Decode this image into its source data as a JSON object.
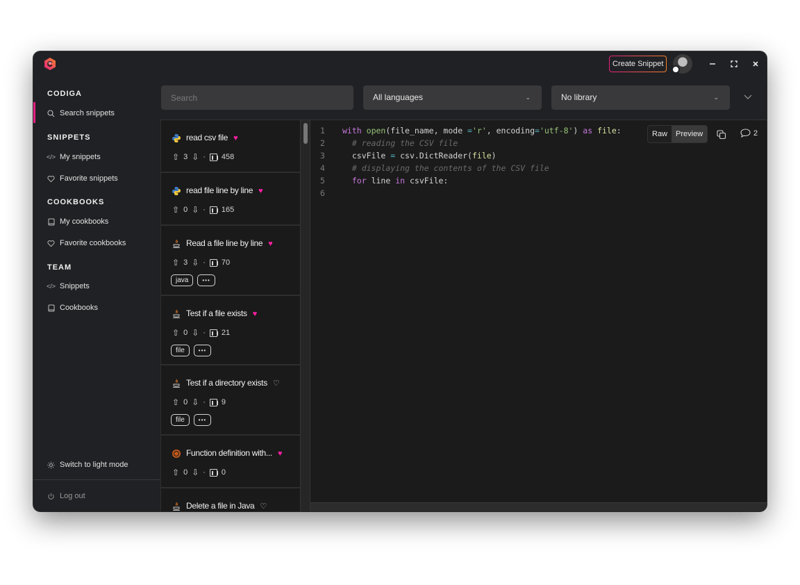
{
  "app": {
    "name": "CODIGA",
    "brand_colors": {
      "primary": "#e5207f",
      "secondary": "#f4842b"
    }
  },
  "titlebar": {
    "create_snippet_label": "Create Snippet",
    "window_controls": [
      "minimize-icon",
      "maximize-icon",
      "close-icon"
    ]
  },
  "sidebar": {
    "sections": [
      {
        "title": "CODIGA",
        "items": [
          {
            "label": "Search snippets",
            "icon": "search-icon",
            "active": true
          }
        ]
      },
      {
        "title": "SNIPPETS",
        "items": [
          {
            "label": "My snippets",
            "icon": "code-icon"
          },
          {
            "label": "Favorite snippets",
            "icon": "heart-icon"
          }
        ]
      },
      {
        "title": "COOKBOOKS",
        "items": [
          {
            "label": "My cookbooks",
            "icon": "book-icon"
          },
          {
            "label": "Favorite cookbooks",
            "icon": "heart-icon"
          }
        ]
      },
      {
        "title": "TEAM",
        "items": [
          {
            "label": "Snippets",
            "icon": "code-icon"
          },
          {
            "label": "Cookbooks",
            "icon": "book-icon"
          }
        ]
      }
    ],
    "switch_theme_label": "Switch to light mode",
    "logout_label": "Log out"
  },
  "filters": {
    "search_placeholder": "Search",
    "search_value": "",
    "language_selected": "All languages",
    "library_selected": "No library"
  },
  "snippets": [
    {
      "title": "read csv file",
      "language": "python",
      "favorite": true,
      "upvotes": "3",
      "views": "458",
      "tags": []
    },
    {
      "title": "read file line by line",
      "language": "python",
      "favorite": true,
      "upvotes": "0",
      "views": "165",
      "tags": []
    },
    {
      "title": "Read a file line by line",
      "language": "java",
      "favorite": true,
      "upvotes": "3",
      "views": "70",
      "tags": [
        "java",
        "..."
      ]
    },
    {
      "title": "Test if a file exists",
      "language": "java",
      "favorite": true,
      "upvotes": "0",
      "views": "21",
      "tags": [
        "file",
        "..."
      ]
    },
    {
      "title": "Test if a directory exists",
      "language": "java",
      "favorite": false,
      "upvotes": "0",
      "views": "9",
      "tags": [
        "file",
        "..."
      ]
    },
    {
      "title": "Function definition with...",
      "language": "rust",
      "favorite": true,
      "upvotes": "0",
      "views": "0",
      "tags": []
    },
    {
      "title": "Delete a file in Java",
      "language": "java",
      "favorite": false,
      "upvotes": "",
      "views": "",
      "tags": []
    }
  ],
  "editor": {
    "view_modes": [
      "Raw",
      "Preview"
    ],
    "active_mode": "Preview",
    "comment_count": "2",
    "line_numbers": [
      "1",
      "2",
      "3",
      "4",
      "5",
      "6"
    ],
    "code_lines": [
      "with open(file_name, mode ='r', encoding='utf-8') as file:",
      "  # reading the CSV file",
      "  csvFile = csv.DictReader(file)",
      "  # displaying the contents of the CSV file",
      "  for line in csvFile:",
      ""
    ]
  }
}
